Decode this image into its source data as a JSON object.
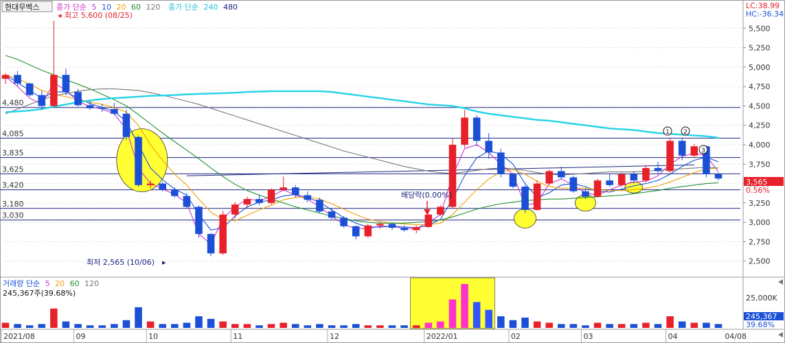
{
  "header": {
    "symbol": "현대무벡스",
    "ma_label": "종가 단순",
    "ma_periods": [
      "5",
      "10",
      "20",
      "60",
      "120"
    ],
    "ma_long_label": "종가 단순",
    "ma_long_periods": [
      "240",
      "480"
    ],
    "lc": "LC:38.99",
    "hc": "HC:-36.34"
  },
  "volume_header": {
    "label": "거래량 단순",
    "periods": [
      "5",
      "20",
      "60",
      "120"
    ],
    "current": "245,367주(39.68%)"
  },
  "annotations": {
    "high": "최고 5,600 (08/25)",
    "low": "최저 2,565 (10/06)",
    "dividend": "배당락(0.00%)",
    "markers": [
      "1",
      "2",
      "3"
    ]
  },
  "price_badge": {
    "price": "3,565",
    "change": "0.56%"
  },
  "volume_badge": {
    "value": "245,367",
    "ratio": "39.68%"
  },
  "colors": {
    "up": "#e8202a",
    "down": "#1a4fd6",
    "ma5": "#cc33cc",
    "ma10": "#1a4fd6",
    "ma20": "#f0a000",
    "ma60": "#1f8f2f",
    "ma120": "#777777",
    "ma240": "#22d3e8",
    "highlight": "#ffff33",
    "level_line": "#1a237e",
    "right_red": "#e8202a",
    "right_blue": "#1a4fd6"
  },
  "chart_data": {
    "type": "candlestick",
    "title": "현대무벡스",
    "x_ticks": [
      "2021/08",
      "09",
      "10",
      "11",
      "12",
      "2022/01",
      "02",
      "03",
      "04",
      "04/08"
    ],
    "y_ticks": [
      2500,
      2750,
      3000,
      3250,
      3500,
      3750,
      4000,
      4250,
      4500,
      4750,
      5000,
      5250,
      5500
    ],
    "ylim": [
      2400,
      5600
    ],
    "volume_ticks": [
      "25,000K"
    ],
    "horizontal_levels": [
      4480,
      4085,
      3835,
      3625,
      3420,
      3180,
      3030
    ],
    "current_price": 3565,
    "series": [
      {
        "name": "5",
        "values": [
          4880,
          4750,
          4600,
          4520,
          4800,
          4700,
          4560,
          4490,
          4460,
          4400,
          4200,
          3700,
          3500,
          3430,
          3360,
          3250,
          2850,
          2720,
          3050,
          3200,
          3300,
          3280,
          3330,
          3420,
          3350,
          3300,
          3200,
          3080,
          2970,
          2920,
          2920,
          2950,
          2950,
          2920,
          2920,
          3000,
          3100,
          3600,
          3950,
          4000,
          3900,
          3750,
          3620,
          3220,
          3250,
          3500,
          3560,
          3480,
          3380,
          3350,
          3420,
          3480,
          3520,
          3530,
          3600,
          3750,
          3850,
          3890,
          3860,
          3650
        ]
      },
      {
        "name": "10",
        "values": [
          4900,
          4800,
          4700,
          4600,
          4680,
          4680,
          4600,
          4530,
          4480,
          4430,
          4300,
          4000,
          3700,
          3550,
          3430,
          3350,
          3100,
          2900,
          2930,
          3080,
          3200,
          3260,
          3290,
          3340,
          3360,
          3320,
          3260,
          3160,
          3060,
          2990,
          2940,
          2940,
          2950,
          2940,
          2930,
          2960,
          3040,
          3300,
          3600,
          3830,
          3920,
          3880,
          3750,
          3500,
          3320,
          3380,
          3480,
          3500,
          3460,
          3400,
          3390,
          3430,
          3470,
          3500,
          3540,
          3620,
          3720,
          3800,
          3840,
          3780
        ]
      },
      {
        "name": "20",
        "values": [
          4900,
          4850,
          4780,
          4700,
          4650,
          4620,
          4580,
          4550,
          4520,
          4480,
          4420,
          4250,
          4000,
          3800,
          3620,
          3480,
          3300,
          3130,
          3040,
          3020,
          3090,
          3160,
          3220,
          3290,
          3320,
          3330,
          3300,
          3240,
          3170,
          3100,
          3040,
          3010,
          2990,
          2980,
          2970,
          2970,
          2990,
          3100,
          3260,
          3420,
          3560,
          3650,
          3680,
          3620,
          3530,
          3460,
          3440,
          3440,
          3440,
          3420,
          3410,
          3410,
          3420,
          3440,
          3470,
          3520,
          3580,
          3640,
          3690,
          3700
        ]
      },
      {
        "name": "60",
        "values": [
          5150,
          5100,
          5030,
          4960,
          4900,
          4840,
          4780,
          4720,
          4650,
          4580,
          4500,
          4390,
          4270,
          4150,
          4040,
          3930,
          3820,
          3700,
          3590,
          3490,
          3410,
          3350,
          3300,
          3250,
          3200,
          3160,
          3120,
          3080,
          3050,
          3020,
          3000,
          2990,
          2990,
          2990,
          3000,
          3010,
          3030,
          3070,
          3120,
          3170,
          3210,
          3240,
          3260,
          3280,
          3290,
          3300,
          3300,
          3310,
          3320,
          3330,
          3340,
          3350,
          3370,
          3390,
          3410,
          3440,
          3460,
          3480,
          3500,
          3510
        ]
      },
      {
        "name": "120",
        "values": [
          4400,
          4460,
          4520,
          4580,
          4630,
          4660,
          4690,
          4710,
          4720,
          4720,
          4710,
          4700,
          4670,
          4640,
          4600,
          4560,
          4520,
          4470,
          4420,
          4370,
          4320,
          4270,
          4220,
          4170,
          4120,
          4070,
          4020,
          3970,
          3920,
          3880,
          3840,
          3800,
          3760,
          3720,
          3690,
          3660,
          3640,
          3630,
          3650,
          3670,
          3690,
          3700,
          3690,
          3670,
          3640,
          3620,
          3610,
          3620,
          3630,
          3640,
          3650,
          3650,
          3650,
          3660,
          3670,
          3680,
          3690,
          3700,
          3710,
          3700
        ]
      },
      {
        "name": "240",
        "values": [
          4420,
          4430,
          4440,
          4460,
          4490,
          4520,
          4550,
          4570,
          4590,
          4600,
          4610,
          4620,
          4630,
          4635,
          4640,
          4650,
          4655,
          4660,
          4665,
          4670,
          4680,
          4685,
          4690,
          4690,
          4690,
          4690,
          4690,
          4680,
          4660,
          4640,
          4620,
          4600,
          4580,
          4560,
          4540,
          4520,
          4510,
          4500,
          4470,
          4430,
          4400,
          4380,
          4360,
          4340,
          4320,
          4310,
          4290,
          4270,
          4250,
          4230,
          4210,
          4200,
          4190,
          4170,
          4150,
          4140,
          4130,
          4120,
          4110,
          4090
        ]
      }
    ],
    "candles": [
      [
        4850,
        4920,
        4780,
        4900
      ],
      [
        4900,
        4950,
        4760,
        4790
      ],
      [
        4790,
        4800,
        4620,
        4640
      ],
      [
        4640,
        4700,
        4450,
        4500
      ],
      [
        4500,
        5600,
        4480,
        4900
      ],
      [
        4900,
        4980,
        4640,
        4680
      ],
      [
        4680,
        4720,
        4490,
        4510
      ],
      [
        4510,
        4560,
        4450,
        4470
      ],
      [
        4470,
        4530,
        4420,
        4460
      ],
      [
        4460,
        4540,
        4380,
        4400
      ],
      [
        4400,
        4450,
        4060,
        4100
      ],
      [
        4100,
        4120,
        3460,
        3480
      ],
      [
        3480,
        3540,
        3440,
        3500
      ],
      [
        3500,
        3520,
        3400,
        3420
      ],
      [
        3420,
        3450,
        3320,
        3340
      ],
      [
        3340,
        3380,
        3180,
        3200
      ],
      [
        3200,
        3220,
        2800,
        2850
      ],
      [
        2850,
        2860,
        2565,
        2600
      ],
      [
        2600,
        3150,
        2580,
        3100
      ],
      [
        3100,
        3260,
        3050,
        3230
      ],
      [
        3230,
        3330,
        3180,
        3300
      ],
      [
        3300,
        3360,
        3220,
        3250
      ],
      [
        3250,
        3440,
        3230,
        3420
      ],
      [
        3420,
        3590,
        3400,
        3450
      ],
      [
        3450,
        3480,
        3320,
        3350
      ],
      [
        3350,
        3400,
        3260,
        3290
      ],
      [
        3290,
        3320,
        3120,
        3140
      ],
      [
        3140,
        3180,
        3040,
        3060
      ],
      [
        3060,
        3080,
        2930,
        2950
      ],
      [
        2950,
        2960,
        2780,
        2820
      ],
      [
        2820,
        2980,
        2800,
        2960
      ],
      [
        2960,
        3010,
        2920,
        2980
      ],
      [
        2980,
        3000,
        2900,
        2930
      ],
      [
        2930,
        2960,
        2880,
        2900
      ],
      [
        2900,
        2960,
        2860,
        2940
      ],
      [
        2940,
        3120,
        2930,
        3100
      ],
      [
        3100,
        3220,
        3080,
        3200
      ],
      [
        3200,
        4080,
        3180,
        4000
      ],
      [
        4000,
        4450,
        3960,
        4350
      ],
      [
        4350,
        4380,
        3980,
        4050
      ],
      [
        4050,
        4150,
        3820,
        3900
      ],
      [
        3900,
        3950,
        3580,
        3620
      ],
      [
        3620,
        3640,
        3440,
        3460
      ],
      [
        3460,
        3480,
        3120,
        3160
      ],
      [
        3160,
        3540,
        3150,
        3500
      ],
      [
        3500,
        3680,
        3480,
        3660
      ],
      [
        3660,
        3720,
        3560,
        3580
      ],
      [
        3580,
        3600,
        3380,
        3400
      ],
      [
        3400,
        3440,
        3300,
        3330
      ],
      [
        3330,
        3560,
        3320,
        3540
      ],
      [
        3540,
        3620,
        3460,
        3480
      ],
      [
        3480,
        3640,
        3460,
        3620
      ],
      [
        3620,
        3660,
        3500,
        3540
      ],
      [
        3540,
        3740,
        3520,
        3700
      ],
      [
        3700,
        3780,
        3620,
        3660
      ],
      [
        3660,
        4080,
        3640,
        4050
      ],
      [
        4050,
        4090,
        3800,
        3860
      ],
      [
        3860,
        4010,
        3840,
        3980
      ],
      [
        3980,
        3990,
        3580,
        3620
      ],
      [
        3620,
        3640,
        3540,
        3565
      ]
    ],
    "volume": [
      4,
      3,
      2,
      3,
      15,
      5,
      3,
      2,
      2,
      3,
      6,
      16,
      5,
      3,
      3,
      4,
      9,
      7,
      5,
      3,
      3,
      2,
      3,
      4,
      3,
      2,
      3,
      2,
      2,
      3,
      2,
      2,
      2,
      2,
      2,
      4,
      5,
      22,
      34,
      20,
      14,
      9,
      6,
      8,
      5,
      4,
      3,
      3,
      2,
      4,
      3,
      3,
      3,
      4,
      3,
      9,
      5,
      4,
      4,
      3
    ]
  }
}
